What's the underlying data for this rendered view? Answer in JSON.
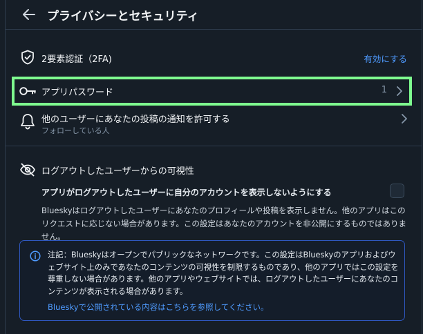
{
  "header": {
    "title": "プライバシーとセキュリティ",
    "back_icon": "arrow-left-icon"
  },
  "two_factor": {
    "label": "2要素認証（2FA)",
    "action": "有効にする",
    "icon": "shield-check-icon"
  },
  "app_passwords": {
    "label": "アプリパスワード",
    "count": "1",
    "icon": "key-icon",
    "highlight_color": "#7efc8f"
  },
  "notifications": {
    "label": "他のユーザーにあなたの投稿の通知を許可する",
    "sublabel": "フォローしている人",
    "icon": "bell-icon"
  },
  "logged_out_visibility": {
    "title": "ログアウトしたユーザーからの可視性",
    "toggle_label": "アプリがログアウトしたユーザーに自分のアカウントを表示しないようにする",
    "checked": false,
    "description": "Blueskyはログアウトしたユーザーにあなたのプロフィールや投稿を表示しません。他のアプリはこのリクエストに応じない場合があります。この設定はあなたのアカウントを非公開にするものではありません。",
    "icon": "eye-slash-icon"
  },
  "notice": {
    "text": "注記：Blueskyはオープンでパブリックなネットワークです。この設定はBlueskyのアプリおよびウェブサイト上のみであなたのコンテンツの可視性を制限するものであり、他のアプリではこの設定を尊重しない場合があります。他のアプリやウェブサイトでは、ログアウトしたユーザーにあなたのコンテンツが表示される場合があります。",
    "link": "Blueskyで公開されている内容はこちらを参照してください。",
    "icon": "info-circle-icon"
  },
  "colors": {
    "background": "#161e27",
    "accent": "#4f9bff",
    "divider": "#2e3c4d",
    "notice_border": "#2f58c0"
  }
}
